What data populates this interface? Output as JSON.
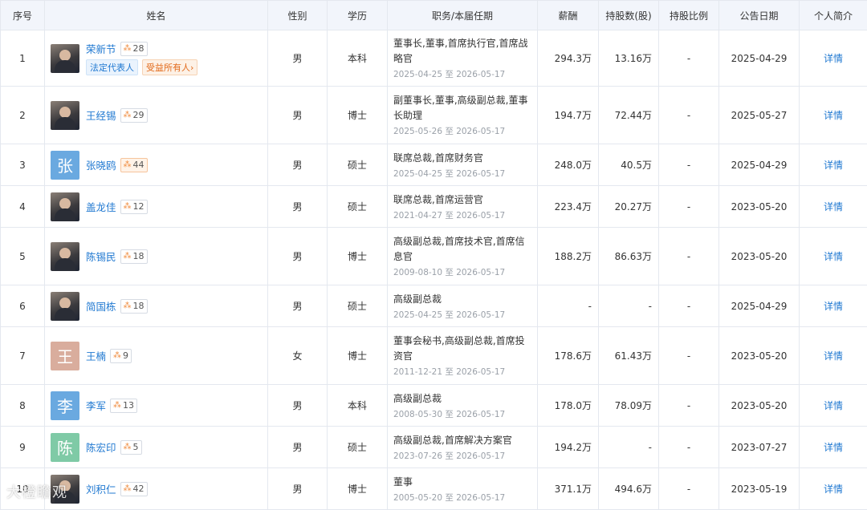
{
  "columns": [
    "序号",
    "姓名",
    "性别",
    "学历",
    "职务/本届任期",
    "薪酬",
    "持股数(股)",
    "持股比例",
    "公告日期",
    "个人简介"
  ],
  "rows": [
    {
      "idx": "1",
      "name": "荣新节",
      "score": "28",
      "avatar_char": "",
      "avatar_color": "",
      "gender": "男",
      "edu": "本科",
      "title": "董事长,董事,首席执行官,首席战略官",
      "term": "2025-04-25 至 2026-05-17",
      "salary": "294.3万",
      "shares": "13.16万",
      "ratio": "-",
      "date": "2025-04-29",
      "detail": "详情",
      "tags": [
        "法定代表人",
        "受益所有人›"
      ]
    },
    {
      "idx": "2",
      "name": "王经锡",
      "score": "29",
      "avatar_char": "",
      "avatar_color": "",
      "gender": "男",
      "edu": "博士",
      "title": "副董事长,董事,高级副总裁,董事长助理",
      "term": "2025-05-26 至 2026-05-17",
      "salary": "194.7万",
      "shares": "72.44万",
      "ratio": "-",
      "date": "2025-05-27",
      "detail": "详情",
      "tags": []
    },
    {
      "idx": "3",
      "name": "张晓鸥",
      "score": "44",
      "avatar_char": "张",
      "avatar_color": "#6aa9e0",
      "gender": "男",
      "edu": "硕士",
      "title": "联席总裁,首席财务官",
      "term": "2025-04-25 至 2026-05-17",
      "salary": "248.0万",
      "shares": "40.5万",
      "ratio": "-",
      "date": "2025-04-29",
      "detail": "详情",
      "tags": []
    },
    {
      "idx": "4",
      "name": "盖龙佳",
      "score": "12",
      "avatar_char": "",
      "avatar_color": "",
      "gender": "男",
      "edu": "硕士",
      "title": "联席总裁,首席运营官",
      "term": "2021-04-27 至 2026-05-17",
      "salary": "223.4万",
      "shares": "20.27万",
      "ratio": "-",
      "date": "2023-05-20",
      "detail": "详情",
      "tags": []
    },
    {
      "idx": "5",
      "name": "陈锡民",
      "score": "18",
      "avatar_char": "",
      "avatar_color": "",
      "gender": "男",
      "edu": "博士",
      "title": "高级副总裁,首席技术官,首席信息官",
      "term": "2009-08-10 至 2026-05-17",
      "salary": "188.2万",
      "shares": "86.63万",
      "ratio": "-",
      "date": "2023-05-20",
      "detail": "详情",
      "tags": []
    },
    {
      "idx": "6",
      "name": "简国栋",
      "score": "18",
      "avatar_char": "",
      "avatar_color": "",
      "gender": "男",
      "edu": "硕士",
      "title": "高级副总裁",
      "term": "2025-04-25 至 2026-05-17",
      "salary": "-",
      "shares": "-",
      "ratio": "-",
      "date": "2025-04-29",
      "detail": "详情",
      "tags": []
    },
    {
      "idx": "7",
      "name": "王楠",
      "score": "9",
      "avatar_char": "王",
      "avatar_color": "#d9ad9d",
      "gender": "女",
      "edu": "博士",
      "title": "董事会秘书,高级副总裁,首席投资官",
      "term": "2011-12-21 至 2026-05-17",
      "salary": "178.6万",
      "shares": "61.43万",
      "ratio": "-",
      "date": "2023-05-20",
      "detail": "详情",
      "tags": []
    },
    {
      "idx": "8",
      "name": "李军",
      "score": "13",
      "avatar_char": "李",
      "avatar_color": "#6aa9e0",
      "gender": "男",
      "edu": "本科",
      "title": "高级副总裁",
      "term": "2008-05-30 至 2026-05-17",
      "salary": "178.0万",
      "shares": "78.09万",
      "ratio": "-",
      "date": "2023-05-20",
      "detail": "详情",
      "tags": []
    },
    {
      "idx": "9",
      "name": "陈宏印",
      "score": "5",
      "avatar_char": "陈",
      "avatar_color": "#7fcaa6",
      "gender": "男",
      "edu": "硕士",
      "title": "高级副总裁,首席解决方案官",
      "term": "2023-07-26 至 2026-05-17",
      "salary": "194.2万",
      "shares": "-",
      "ratio": "-",
      "date": "2023-07-27",
      "detail": "详情",
      "tags": []
    },
    {
      "idx": "10",
      "name": "刘积仁",
      "score": "42",
      "avatar_char": "",
      "avatar_color": "",
      "gender": "男",
      "edu": "博士",
      "title": "董事",
      "term": "2005-05-20 至 2026-05-17",
      "salary": "371.1万",
      "shares": "494.6万",
      "ratio": "-",
      "date": "2023-05-19",
      "detail": "详情",
      "tags": []
    }
  ],
  "watermark": "大橙瞻观",
  "colors": {
    "link": "#1f78d1",
    "header_bg": "#f2f5fb",
    "border": "#e4e8ef",
    "score_icon": "#f08a3c"
  }
}
